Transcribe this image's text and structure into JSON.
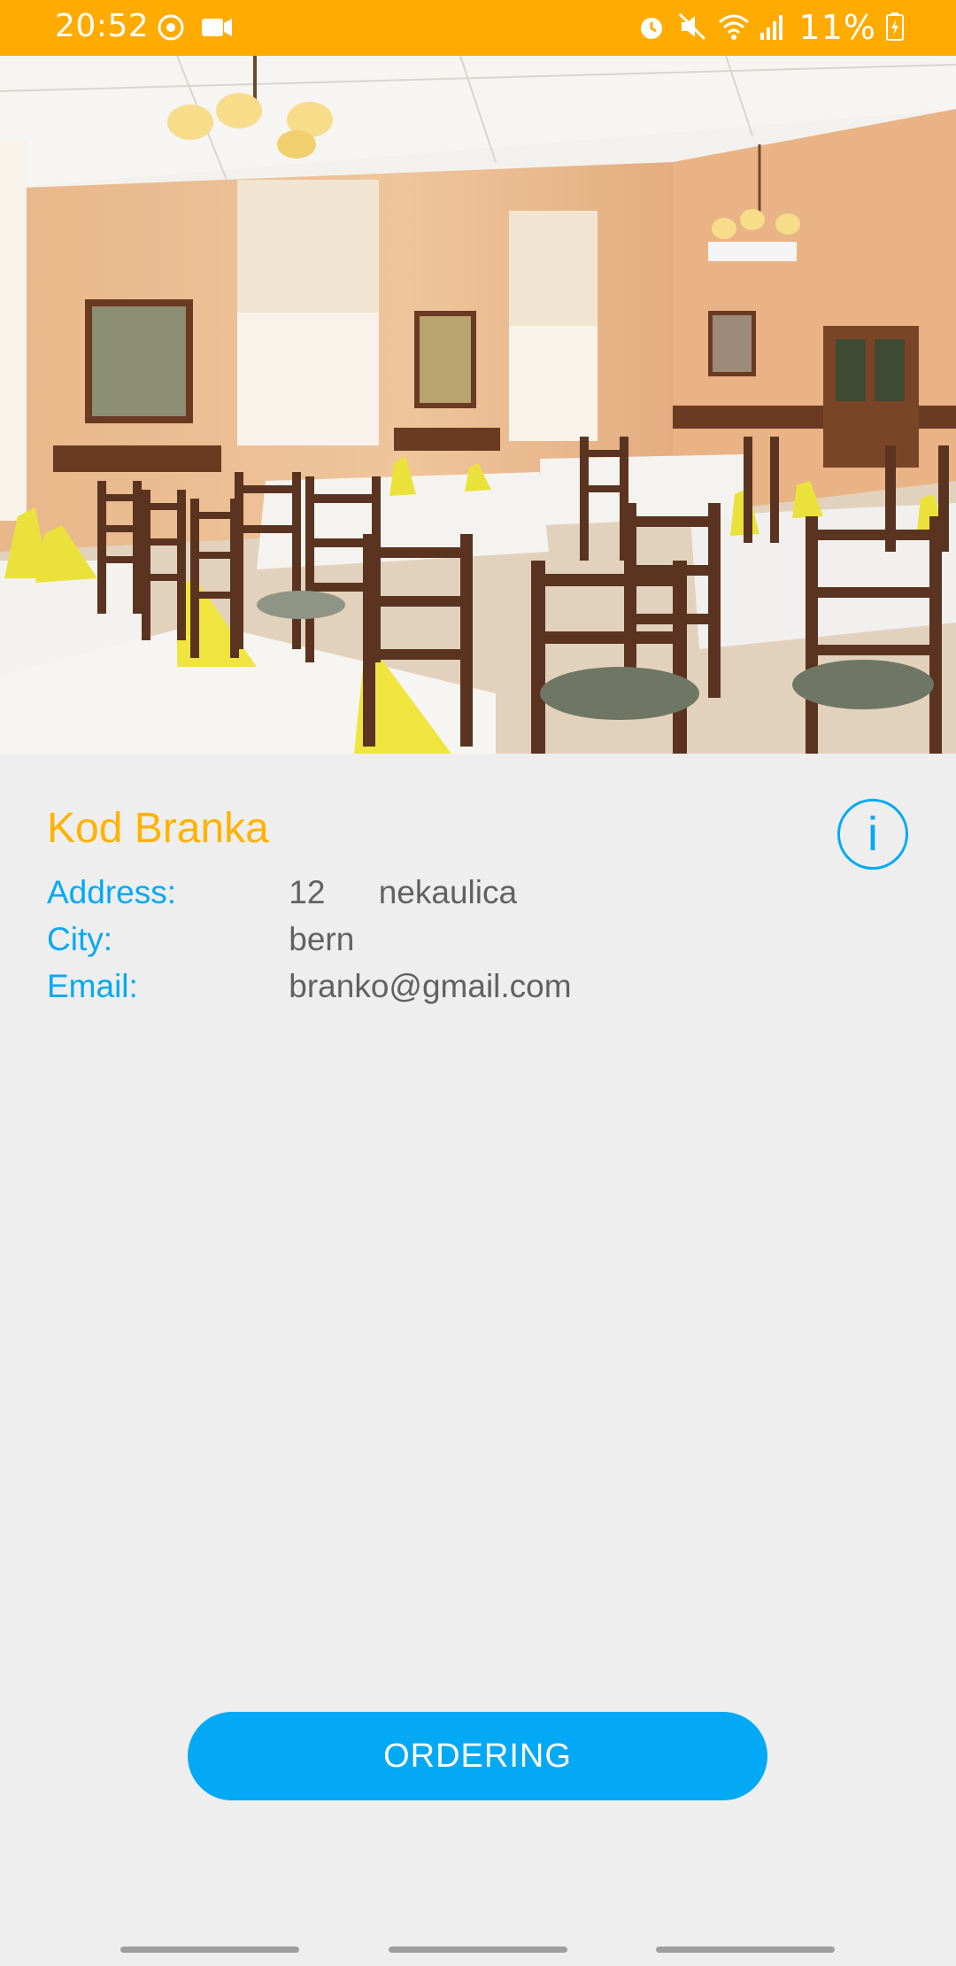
{
  "status_bar": {
    "time": "20:52",
    "battery": "11%",
    "left_icons": [
      "sync-icon",
      "video-icon"
    ],
    "right_icons": [
      "alarm-icon",
      "mute-icon",
      "wifi-icon",
      "signal-icon",
      "battery-icon"
    ],
    "color": "#ffab00"
  },
  "restaurant": {
    "name": "Kod Branka",
    "fields": [
      {
        "label": "Address:",
        "value_number": "12",
        "value": "nekaulica"
      },
      {
        "label": "City:",
        "value": "bern"
      },
      {
        "label": "Email:",
        "value": "branko@gmail.com"
      }
    ]
  },
  "actions": {
    "order_label": "ORDERING",
    "info_label": "i"
  },
  "colors": {
    "accent": "#03a9f4",
    "title": "#ffb300",
    "text": "#616161",
    "background": "#eeeeee"
  }
}
